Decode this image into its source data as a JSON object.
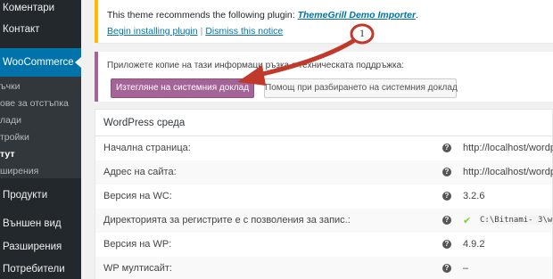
{
  "sidebar": {
    "comments": "Коментари",
    "contact": "Контакт",
    "woocommerce": "WooCommerce",
    "sub_orders": "ъчки",
    "sub_coupons": "ове за отстъпка",
    "sub_reports": "лади",
    "sub_settings": "тройки",
    "sub_status": "тут",
    "sub_extensions": "ширения",
    "products": "Продукти",
    "appearance": "Външен вид",
    "plugins": "Разширения",
    "users": "Потребители"
  },
  "notice": {
    "text_prefix": "This theme recommends the following plugin: ",
    "plugin_name": "ThemeGrill Demo Importer",
    "text_suffix": ".",
    "begin_link": "Begin installing plugin",
    "separator": "|",
    "dismiss_link": "Dismiss this notice"
  },
  "support": {
    "text": "Приложете копие на тази информаци         ръзка с техническата поддръжка:",
    "download_button": "Изтегляне на системния доклад",
    "help_button": "Помощ при разбирането на системния доклад"
  },
  "annotation": {
    "number": "1"
  },
  "table": {
    "title": "WordPress среда",
    "rows": [
      {
        "label": "Начална страница:",
        "value": "http://localhost/wordp"
      },
      {
        "label": "Адрес на сайта:",
        "value": "http://localhost/wordp"
      },
      {
        "label": "Версия на WC:",
        "value": "3.2.6"
      },
      {
        "label": "Директорията за регистрите е с позволения за запис.:",
        "check": "✔",
        "value": "C:\\Bitnami- 3\\w"
      },
      {
        "label": "Версия на WP:",
        "value": "4.9.2"
      },
      {
        "label": "WP мултисайт:",
        "value": "–"
      }
    ],
    "help_glyph": "?"
  },
  "colors": {
    "sidebar_bg": "#23282d",
    "active_menu": "#0073aa",
    "notice_border": "#ffb900",
    "woo_purple": "#a46497",
    "arrow_red": "#c0392b",
    "check_green": "#7ad03a"
  }
}
